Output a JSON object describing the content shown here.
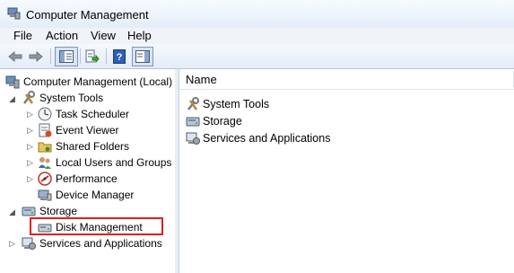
{
  "window": {
    "title": "Computer Management"
  },
  "menu": [
    "File",
    "Action",
    "View",
    "Help"
  ],
  "toolbar": {
    "buttons": [
      "back-icon",
      "forward-icon",
      "show-hide-tree-icon",
      "export-list-icon",
      "help-icon",
      "show-hide-action-pane-icon"
    ]
  },
  "tree": {
    "root": "Computer Management (Local)",
    "system_tools": "System Tools",
    "task_scheduler": "Task Scheduler",
    "event_viewer": "Event Viewer",
    "shared_folders": "Shared Folders",
    "local_users": "Local Users and Groups",
    "performance": "Performance",
    "device_manager": "Device Manager",
    "storage": "Storage",
    "disk_management": "Disk Management",
    "services": "Services and Applications"
  },
  "list": {
    "column": "Name",
    "items": [
      "System Tools",
      "Storage",
      "Services and Applications"
    ]
  },
  "colors": {
    "highlight": "#e02020"
  }
}
